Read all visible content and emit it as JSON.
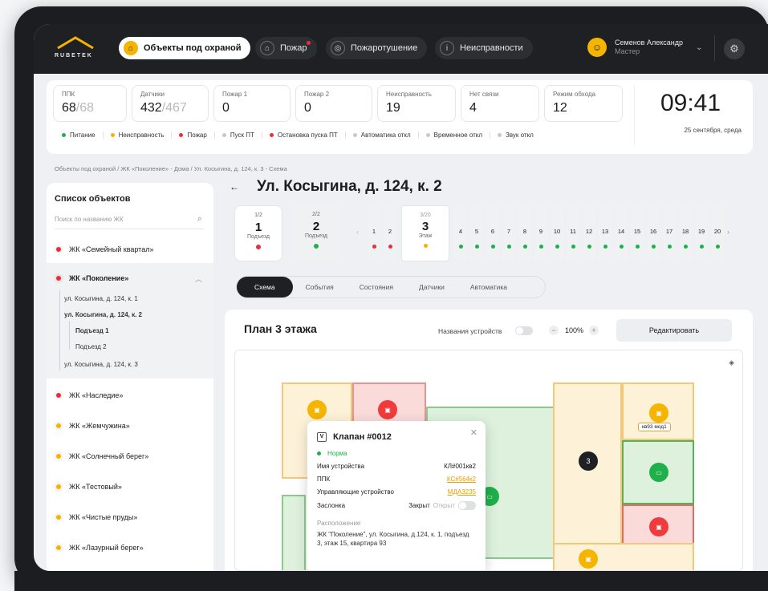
{
  "topbar": {
    "logo": "RUBETEK",
    "tabs": [
      {
        "label": "Объекты под охраной",
        "icon": "home-icon",
        "active": true
      },
      {
        "label": "Пожар",
        "icon": "fire-icon",
        "alert": true
      },
      {
        "label": "Пожаротушение",
        "icon": "extinguish-icon"
      },
      {
        "label": "Неисправности",
        "icon": "info-icon"
      }
    ],
    "user": {
      "name": "Семенов Александр",
      "role": "Мастер"
    }
  },
  "stats": [
    {
      "label": "ППК",
      "value": "68",
      "total": "/68"
    },
    {
      "label": "Датчики",
      "value": "432",
      "total": "/467"
    },
    {
      "label": "Пожар 1",
      "value": "0"
    },
    {
      "label": "Пожар 2",
      "value": "0"
    },
    {
      "label": "Неисправность",
      "value": "19"
    },
    {
      "label": "Нет связи",
      "value": "4"
    },
    {
      "label": "Режим обхода",
      "value": "12"
    }
  ],
  "clock": {
    "time": "09:41",
    "date": "25 сентября, среда"
  },
  "legend": [
    {
      "label": "Питание",
      "color": "#20b04b"
    },
    {
      "label": "Неисправность",
      "color": "#f5b400"
    },
    {
      "label": "Пожар",
      "color": "#ef2b3a"
    },
    {
      "label": "Пуск ПТ",
      "color": "#c7c8cc"
    },
    {
      "label": "Остановка пуска ПТ",
      "color": "#ef2b3a"
    },
    {
      "label": "Автоматика откл",
      "color": "#c7c8cc"
    },
    {
      "label": "Временное откл",
      "color": "#c7c8cc"
    },
    {
      "label": "Звук откл",
      "color": "#c7c8cc"
    }
  ],
  "breadcrumb": "Объекты под охраной  /  ЖК «Поколение» - Дома  /  Ул. Косыгина, д. 124, к. 3 - Схема",
  "sidebar": {
    "title": "Список объектов",
    "search_placeholder": "Поиск по названию ЖК",
    "objects": [
      {
        "label": "ЖК «Семейный квартал»",
        "color": "#ef2b3a"
      },
      {
        "label": "ЖК «Поколение»",
        "color": "#ef2b3a"
      },
      {
        "label": "ЖК «Наследие»",
        "color": "#ef2b3a"
      },
      {
        "label": "ЖК «Жемчужина»",
        "color": "#f5b400"
      },
      {
        "label": "ЖК «Солнечный берег»",
        "color": "#f5b400"
      },
      {
        "label": "ЖК «Тестовый»",
        "color": "#f5b400"
      },
      {
        "label": "ЖК «Чистые пруды»",
        "color": "#f5b400"
      },
      {
        "label": "ЖК «Лазурный берег»",
        "color": "#f5b400"
      }
    ],
    "subitems": [
      "ул. Косыгина, д. 124, к. 1",
      "ул. Косыгина, д. 124, к. 2",
      "Подъезд 1",
      "Подъезд 2",
      "ул. Косыгина, д. 124, к. 3"
    ]
  },
  "main": {
    "title": "Ул. Косыгина, д. 124, к. 2",
    "entrances": [
      {
        "frac": "1/2",
        "num": "1",
        "label": "Подъезд",
        "color": "#ef2b3a"
      },
      {
        "frac": "2/2",
        "num": "2",
        "label": "Подъезд",
        "color": "#20b04b"
      }
    ],
    "current_floor": {
      "frac": "3/20",
      "num": "3",
      "label": "Этаж"
    },
    "floors": [
      "1",
      "2",
      "4",
      "5",
      "6",
      "7",
      "8",
      "9",
      "10",
      "11",
      "12",
      "13",
      "14",
      "15",
      "16",
      "17",
      "18",
      "19",
      "20"
    ],
    "tabs": [
      "Схема",
      "События",
      "Состояния",
      "Датчики",
      "Автоматика"
    ],
    "plan_title": "План 3 этажа",
    "device_names_label": "Названия устройств",
    "zoom": "100%",
    "edit_label": "Редактировать",
    "flat_label": "кв93 мод1",
    "node_number": "3"
  },
  "popup": {
    "title": "Клапан #0012",
    "status": "Норма",
    "rows": [
      {
        "k": "Имя устройства",
        "v": "КЛ#001кв2"
      },
      {
        "k": "ППК",
        "v": "КС#564к2"
      },
      {
        "k": "Управляющие устройство",
        "v": "МДА3235"
      }
    ],
    "damper_label": "Заслонка",
    "closed": "Закрыт",
    "open": "Открыт",
    "location_label": "Расположение",
    "location": "ЖК \"Поколение\", ул. Косыгина, д.124, к. 1, подъезд 3, этаж 15, квартира 93"
  }
}
